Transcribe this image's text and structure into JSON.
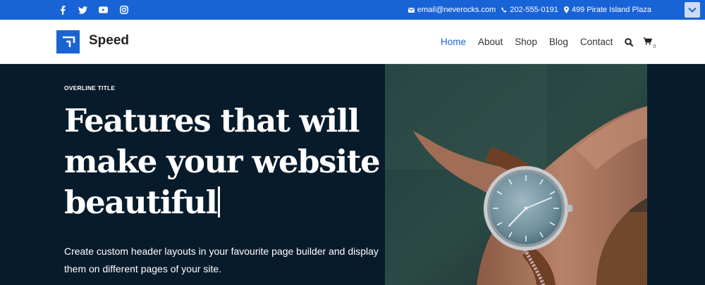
{
  "topbar": {
    "background": "#1863d6",
    "social": [
      {
        "icon": "facebook-icon"
      },
      {
        "icon": "twitter-icon"
      },
      {
        "icon": "youtube-icon"
      },
      {
        "icon": "instagram-icon"
      }
    ],
    "email": "email@neverocks.com",
    "phone": "202-555-0191",
    "address": "499 Pirate Island Plaza",
    "dropdown_icon": "chevron-down-icon"
  },
  "header": {
    "logo_text": "Speed",
    "brand_color": "#1a63d3",
    "nav": [
      {
        "label": "Home",
        "active": true
      },
      {
        "label": "About",
        "active": false
      },
      {
        "label": "Shop",
        "active": false
      },
      {
        "label": "Blog",
        "active": false
      },
      {
        "label": "Contact",
        "active": false
      }
    ],
    "search_icon": "search-icon",
    "cart_icon": "cart-icon",
    "cart_count": "0"
  },
  "hero": {
    "background": "#081b2b",
    "overline": "OVERLINE TITLE",
    "headline": "Features that will make your website beautiful",
    "subtext": "Create custom header layouts in your favourite page builder and display them on different pages of your site.",
    "image": "wristwatch-photo"
  }
}
